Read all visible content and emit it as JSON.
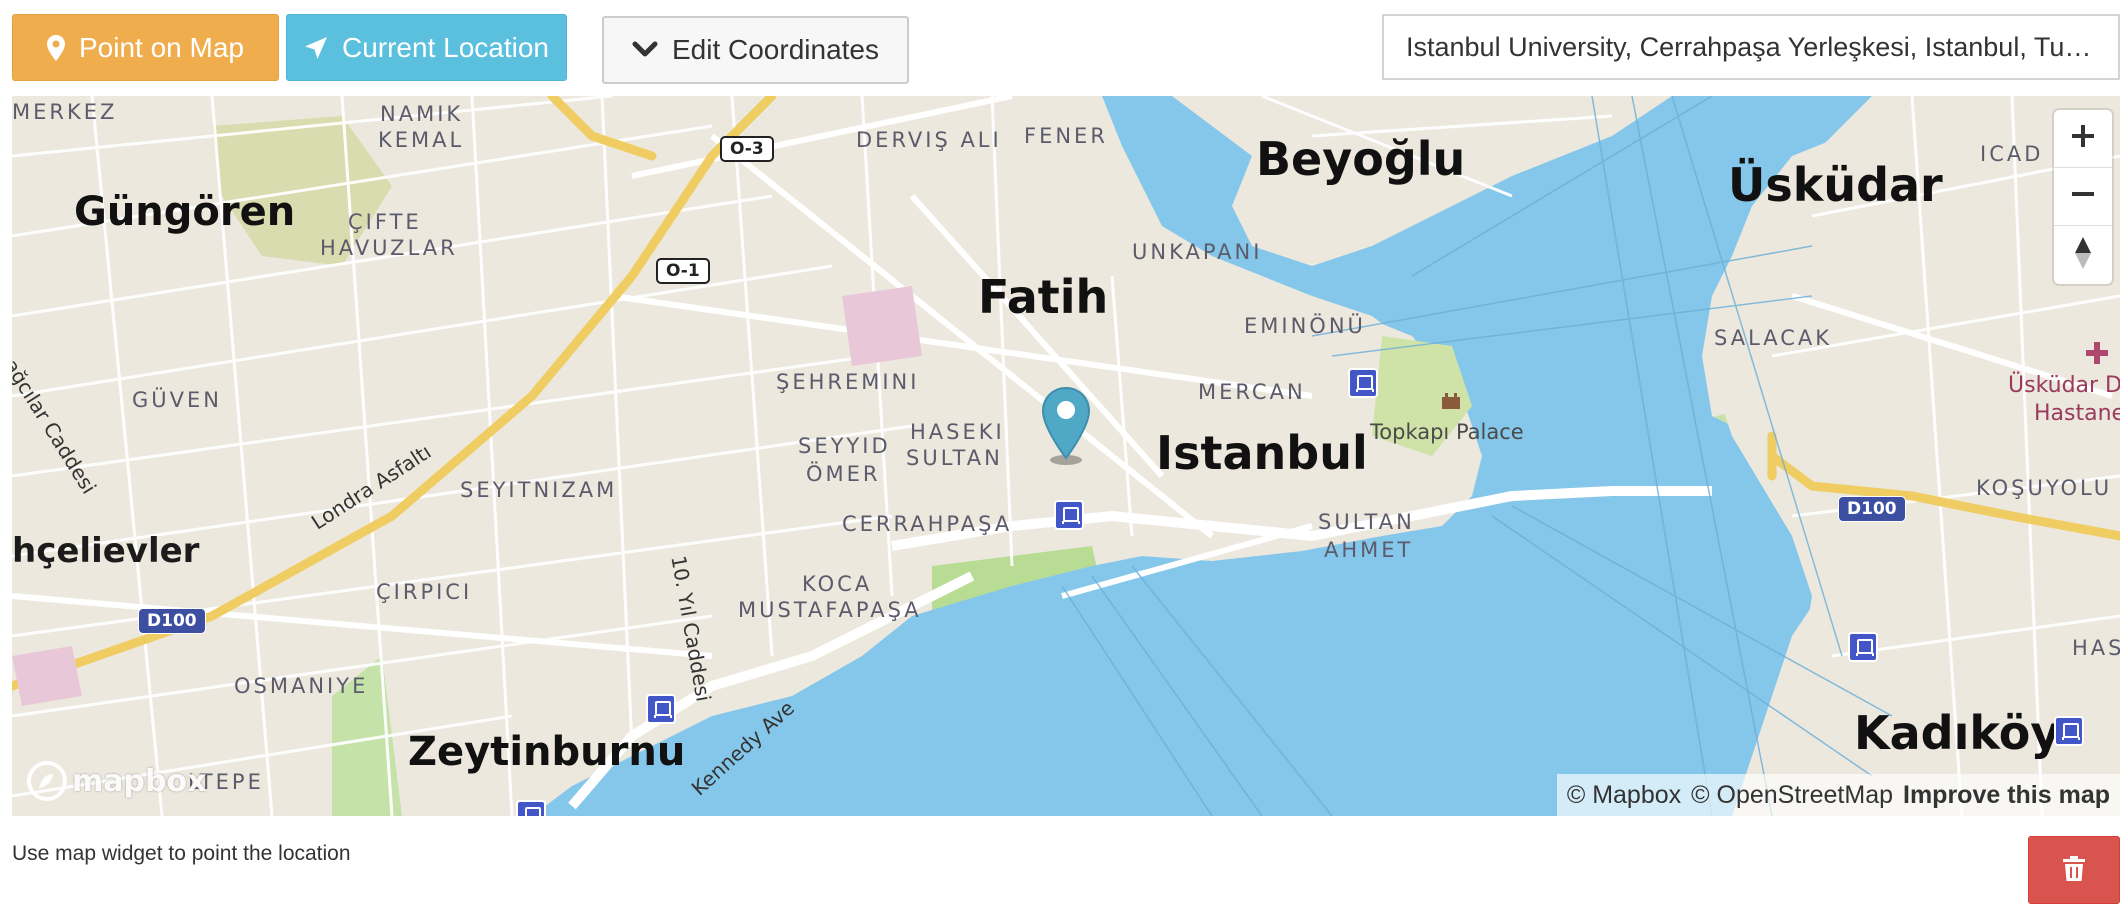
{
  "toolbar": {
    "point_label": "Point on Map",
    "current_label": "Current Location",
    "edit_label": "Edit Coordinates"
  },
  "search": {
    "value": "Istanbul University, Cerrahpaşa Yerleşkesi, Istanbul, Turkey"
  },
  "map": {
    "districts": {
      "fatih": "Fatih",
      "istanbul": "Istanbul",
      "beyoglu": "Beyoğlu",
      "uskudar": "Üsküdar",
      "kadikoy": "Kadıköy",
      "zeytinburnu": "Zeytinburnu",
      "gungoren": "Güngören",
      "bahcelievler": "hçelievler"
    },
    "neighborhoods": {
      "merkez": "MERKEZ",
      "namik": "NAMIK",
      "kemal": "KEMAL",
      "cifte": "ÇIFTE",
      "havuzlar": "HAVUZLAR",
      "dervis": "DERVIŞ ALI",
      "fener": "FENER",
      "unkapani": "UNKAPANI",
      "eminonu": "EMINÖNÜ",
      "sehremini": "ŞEHREMINI",
      "mercan": "MERCAN",
      "guven": "GÜVEN",
      "seyyid": "SEYYID",
      "omer": "ÖMER",
      "haseki": "HASEKI",
      "sultan": "SULTAN",
      "seyitnizam": "SEYITNIZAM",
      "cerrahpasa": "CERRAHPAŞA",
      "sultanahmet1": "SULTAN",
      "sultanahmet2": "AHMET",
      "koca": "KOCA",
      "mustafapasa": "MUSTAFAPAŞA",
      "cirpici": "ÇIRPICI",
      "osmaniye": "OSMANIYE",
      "tepe": "LTEPE",
      "salacak": "SALACAK",
      "kosuyolu": "KOŞUYOLU",
      "icad": "ICAD",
      "has": "HAS"
    },
    "roads": {
      "londra": "Londra Asfaltı",
      "yil": "10. Yıl Caddesi",
      "kennedy": "Kennedy Ave",
      "bagcilar": "ağcılar Caddesi"
    },
    "shields": {
      "o3": "O-3",
      "o1": "O-1",
      "d100_left": "D100",
      "d100_right": "D100"
    },
    "pois": {
      "topkapi": "Topkapı Palace",
      "hospital_line1": "Üsküdar D",
      "hospital_line2": "Hastane"
    },
    "logo_text": "mapbox",
    "attribution": {
      "mapbox": "© Mapbox",
      "osm": "© OpenStreetMap",
      "improve": "Improve this map"
    }
  },
  "hint": "Use map widget to point the location",
  "colors": {
    "warning": "#f0ad4e",
    "info": "#5bc0de",
    "danger": "#d9534f",
    "water": "#85c7ea",
    "land": "#ece8de",
    "park": "#c5e3a8",
    "motorway": "#f1d06a",
    "marker": "#4fa8c6"
  },
  "icons": {
    "point": "map-marker-icon",
    "current": "location-arrow-icon",
    "edit": "chevron-down-icon",
    "zoom_in": "plus-icon",
    "zoom_out": "minus-icon",
    "compass": "compass-icon",
    "delete": "trash-icon"
  }
}
